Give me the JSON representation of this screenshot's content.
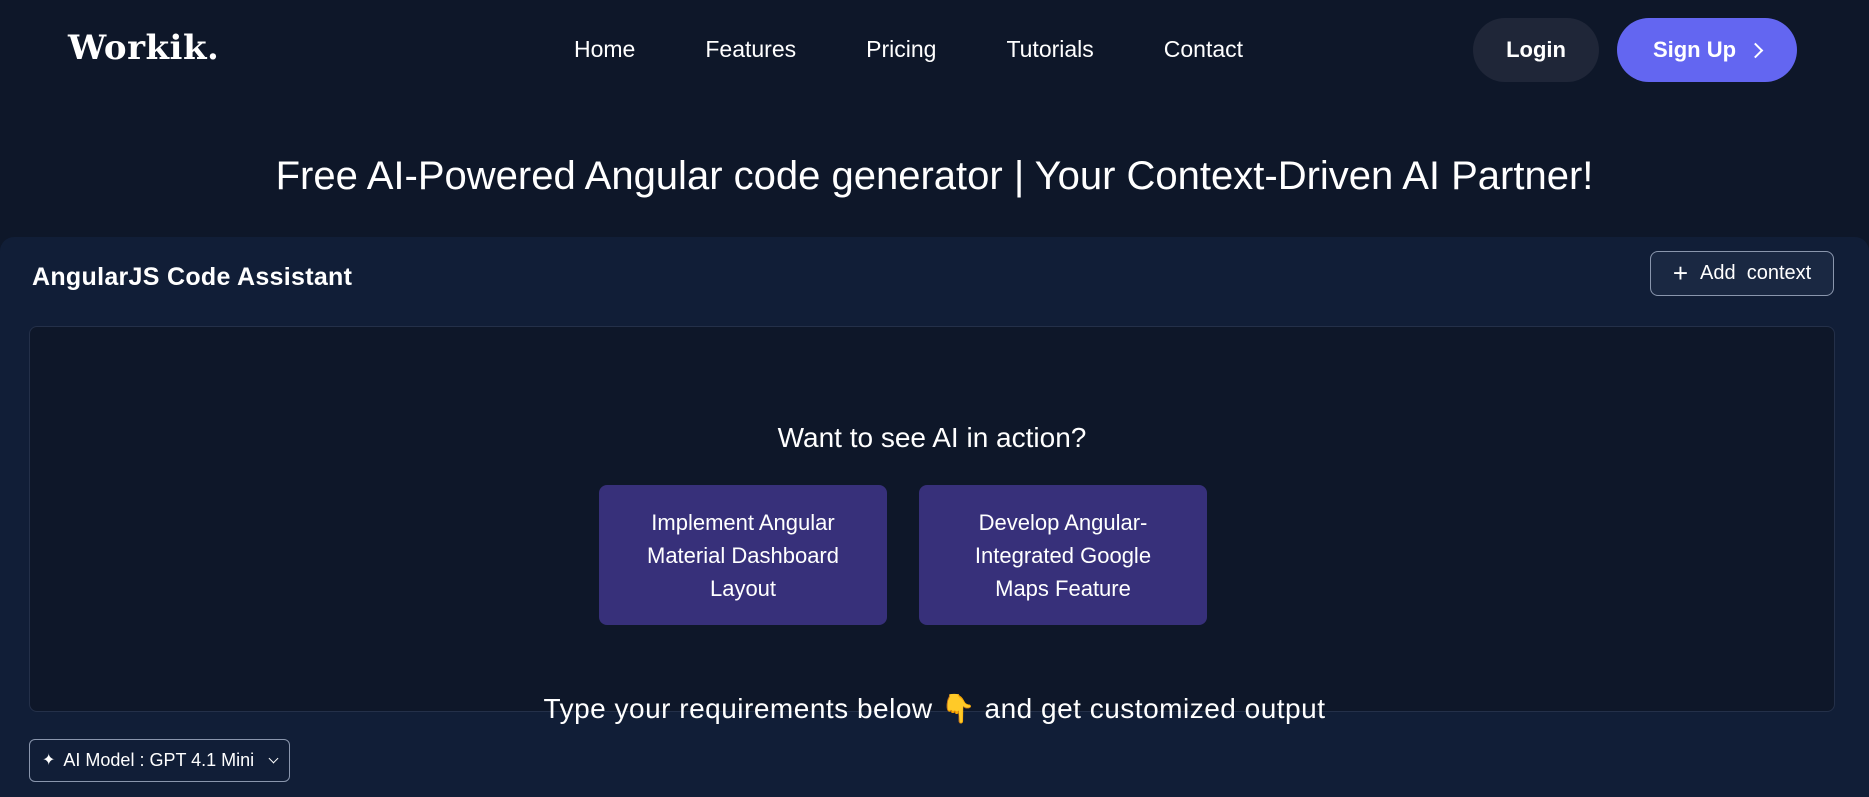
{
  "header": {
    "logo": "Workik.",
    "nav": [
      "Home",
      "Features",
      "Pricing",
      "Tutorials",
      "Contact"
    ],
    "login_label": "Login",
    "signup_label": "Sign Up"
  },
  "hero": {
    "title": "Free AI-Powered Angular code generator | Your Context-Driven AI Partner!"
  },
  "panel": {
    "title": "AngularJS Code Assistant",
    "add_context_label": "Add  context",
    "prompt_heading": "Want to see AI in action?",
    "suggestions": [
      "Implement Angular Material Dashboard Layout",
      "Develop Angular-Integrated Google Maps Feature"
    ],
    "type_hint": "Type your requirements below 👇 and get customized output",
    "model_label": "AI Model : GPT 4.1 Mini"
  },
  "colors": {
    "background": "#0e1729",
    "panel": "#111e37",
    "accent": "#6366f1",
    "suggestion_card": "#37307a"
  }
}
